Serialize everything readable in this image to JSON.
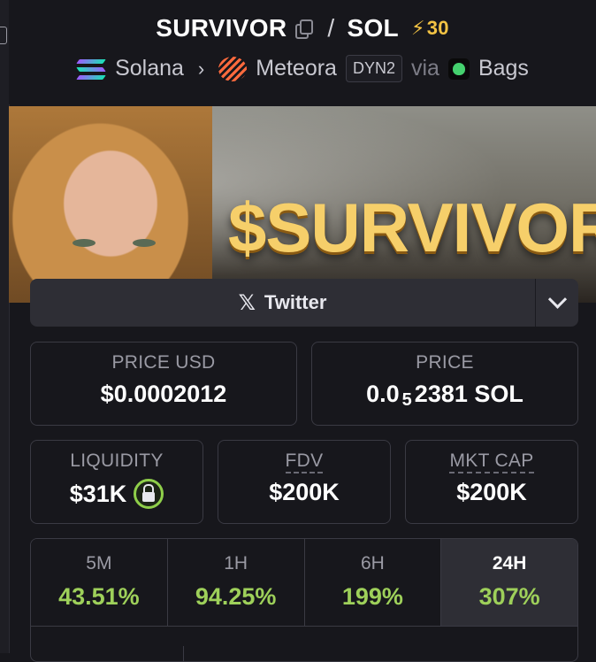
{
  "header": {
    "base_token": "SURVIVOR",
    "separator": "/",
    "quote_token": "SOL",
    "boost_icon": "lightning-icon",
    "boost_count": "30",
    "chain": "Solana",
    "dex": "Meteora",
    "pool_type": "DYN2",
    "via": "via",
    "launchpad": "Bags"
  },
  "banner": {
    "ticker": "$SURVIVOR"
  },
  "social": {
    "twitter_label": "Twitter",
    "icons": [
      "x-icon",
      "chevron-down-icon"
    ]
  },
  "stats": {
    "price_usd": {
      "label": "PRICE USD",
      "value": "$0.0002012"
    },
    "price": {
      "label": "PRICE",
      "prefix": "0.0",
      "sub": "5",
      "rest": "2381 SOL"
    },
    "liquidity": {
      "label": "LIQUIDITY",
      "value": "$31K"
    },
    "fdv": {
      "label": "FDV",
      "value": "$200K"
    },
    "mkt_cap": {
      "label": "MKT CAP",
      "value": "$200K"
    }
  },
  "timeframes": [
    {
      "label": "5M",
      "value": "43.51%"
    },
    {
      "label": "1H",
      "value": "94.25%"
    },
    {
      "label": "6H",
      "value": "199%"
    },
    {
      "label": "24H",
      "value": "307%"
    }
  ],
  "colors": {
    "positive": "#9ed05a",
    "boost": "#f3c344",
    "background": "#17171c"
  }
}
